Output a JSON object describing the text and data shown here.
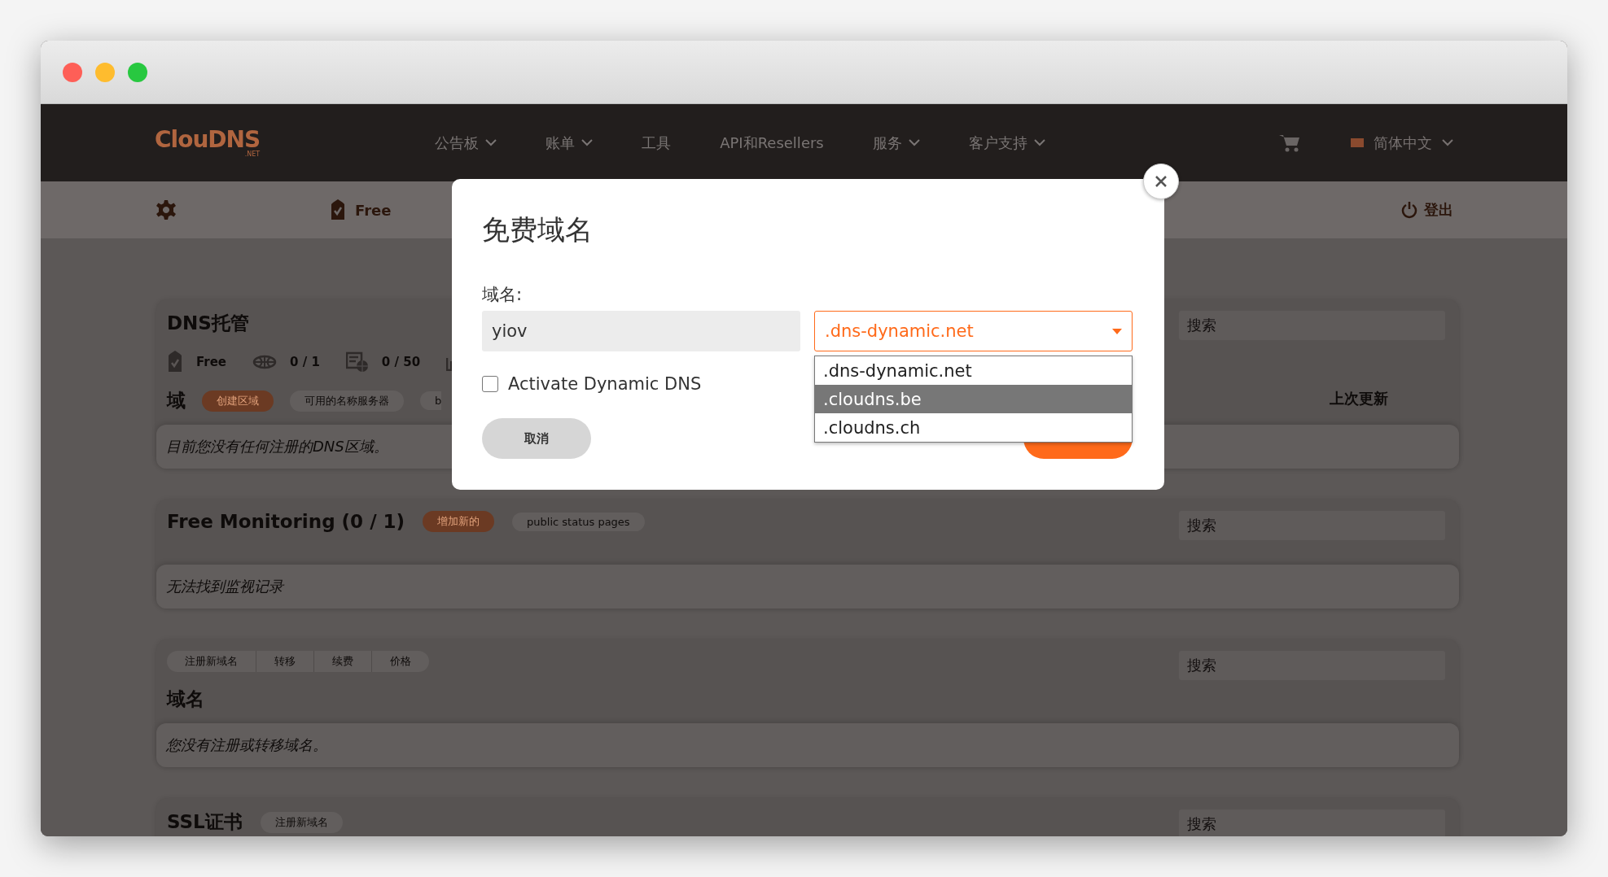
{
  "window": {
    "controls": [
      {
        "color": "#fe5f57"
      },
      {
        "color": "#febc2e"
      },
      {
        "color": "#28c840"
      }
    ]
  },
  "nav": {
    "logo": {
      "text": "ClouDNS",
      "sub": ".NET"
    },
    "items": [
      {
        "label": "公告板",
        "dropdown": true
      },
      {
        "label": "账单",
        "dropdown": true
      },
      {
        "label": "工具",
        "dropdown": false
      },
      {
        "label": "API和Resellers",
        "dropdown": false
      },
      {
        "label": "服务",
        "dropdown": true
      },
      {
        "label": "客户支持",
        "dropdown": true
      }
    ],
    "language": "简体中文"
  },
  "subbar": {
    "plan": "Free",
    "logout": "登出"
  },
  "sections": [
    {
      "title": "DNS托管",
      "stats": [
        {
          "kind": "plan",
          "text": "Free"
        },
        {
          "kind": "globe",
          "text": "0 / 1"
        },
        {
          "kind": "server",
          "text": "0 / 50"
        },
        {
          "kind": "chart"
        }
      ],
      "subtitle": "域",
      "pills": [
        {
          "label": "创建区域",
          "primary": true
        },
        {
          "label": "可用的名称服务器",
          "primary": false
        },
        {
          "label": "b",
          "primary": false
        }
      ],
      "search": {
        "placeholder": "搜索"
      },
      "column_header": "上次更新",
      "message": "目前您没有任何注册的DNS区域。"
    },
    {
      "title": "Free Monitoring (0 / 1)",
      "pills": [
        {
          "label": "增加新的",
          "primary": true
        },
        {
          "label": "public status pages",
          "primary": false
        }
      ],
      "search": {
        "placeholder": "搜索"
      },
      "message": "无法找到监视记录"
    },
    {
      "tabs": [
        "注册新域名",
        "转移",
        "续费",
        "价格"
      ],
      "title": "域名",
      "search": {
        "placeholder": "搜索"
      },
      "message": "您没有注册或转移域名。"
    },
    {
      "title": "SSL证书",
      "pills": [
        {
          "label": "注册新域名",
          "primary": false
        }
      ],
      "search": {
        "placeholder": "搜索"
      }
    }
  ],
  "modal": {
    "title": "免费域名",
    "label": "域名:",
    "name_value": "yiov",
    "zone_select": {
      "value": ".dns-dynamic.net",
      "options": [
        {
          "label": ".dns-dynamic.net",
          "highlighted": false
        },
        {
          "label": ".cloudns.be",
          "highlighted": true
        },
        {
          "label": ".cloudns.ch",
          "highlighted": false
        }
      ]
    },
    "checkbox": {
      "label": "Activate Dynamic DNS",
      "checked": false
    },
    "cancel": "取消"
  }
}
